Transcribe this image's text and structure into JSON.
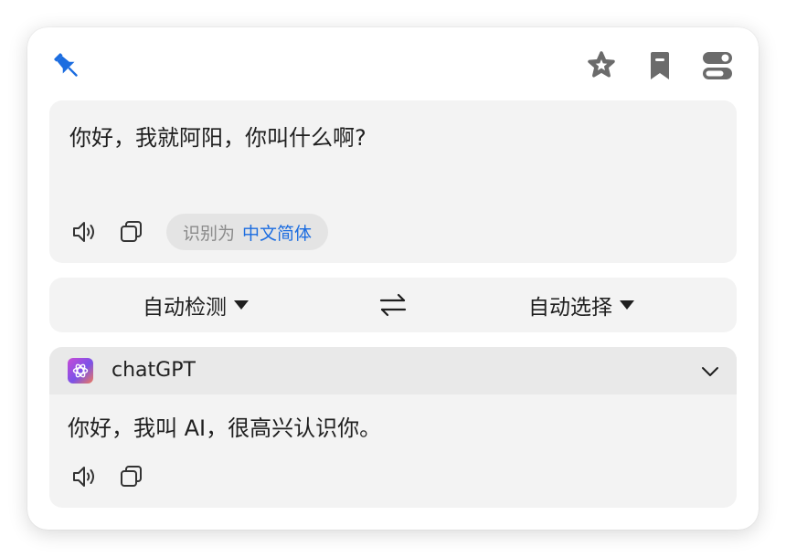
{
  "source": {
    "text": "你好，我就阿阳，你叫什么啊?",
    "detected_label": "识别为",
    "detected_language": "中文简体"
  },
  "languages": {
    "from": "自动检测",
    "to": "自动选择"
  },
  "result": {
    "engine_name": "chatGPT",
    "text": "你好，我叫 AI，很高兴认识你。"
  },
  "colors": {
    "accent": "#1c6de0",
    "panel_bg": "#f3f3f3",
    "header_bg": "#e9e9e9",
    "icon_gray": "#6b6b6b"
  },
  "icons": {
    "pin": "pin-icon",
    "favorite": "star-icon",
    "bookmark": "bookmark-icon",
    "settings_toggle": "toggle-icon",
    "speak": "speaker-icon",
    "copy": "copy-icon",
    "swap": "swap-icon",
    "collapse": "chevron-down-icon",
    "engine": "openai-logo-icon"
  }
}
